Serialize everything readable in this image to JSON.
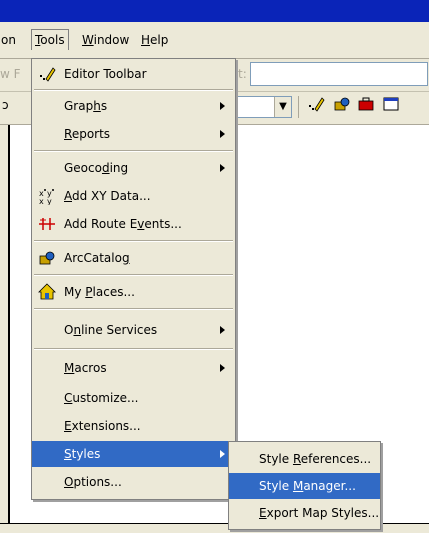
{
  "menubar": {
    "partial_left": "on",
    "items": [
      {
        "label": "Tools",
        "key": "T",
        "rest": "ools"
      },
      {
        "label": "Window",
        "key": "W",
        "rest": "indow"
      },
      {
        "label": "Help",
        "key": "H",
        "rest": "elp"
      }
    ]
  },
  "toolbar1": {
    "partial_label": "w F",
    "partial_label2": "t:"
  },
  "tools_menu": {
    "items": [
      {
        "pre": "",
        "key": "",
        "post": "Editor Toolbar",
        "icon": "editor-pencil-icon"
      },
      {
        "pre": "Grap",
        "key": "h",
        "post": "s"
      },
      {
        "pre": "",
        "key": "R",
        "post": "eports"
      },
      {
        "pre": "Geoco",
        "key": "d",
        "post": "ing"
      },
      {
        "pre": "",
        "key": "A",
        "post": "dd XY Data...",
        "icon": "xy-data-icon"
      },
      {
        "pre": "Add Route E",
        "key": "v",
        "post": "ents...",
        "icon": "route-events-icon"
      },
      {
        "pre": "ArcCatalo",
        "key": "g",
        "post": "",
        "icon": "arccatalog-icon"
      },
      {
        "pre": "My ",
        "key": "P",
        "post": "laces...",
        "icon": "house-icon"
      },
      {
        "pre": "O",
        "key": "n",
        "post": "line Services"
      },
      {
        "pre": "",
        "key": "M",
        "post": "acros"
      },
      {
        "pre": "",
        "key": "C",
        "post": "ustomize..."
      },
      {
        "pre": "",
        "key": "E",
        "post": "xtensions..."
      },
      {
        "pre": "",
        "key": "S",
        "post": "tyles"
      },
      {
        "pre": "",
        "key": "O",
        "post": "ptions..."
      }
    ]
  },
  "styles_menu": {
    "items": [
      {
        "pre": "Style ",
        "key": "R",
        "post": "eferences..."
      },
      {
        "pre": "Style ",
        "key": "M",
        "post": "anager..."
      },
      {
        "pre": "",
        "key": "E",
        "post": "xport Map Styles..."
      }
    ]
  },
  "colors": {
    "highlight": "#316ac5",
    "menu_bg": "#ece9d8"
  }
}
